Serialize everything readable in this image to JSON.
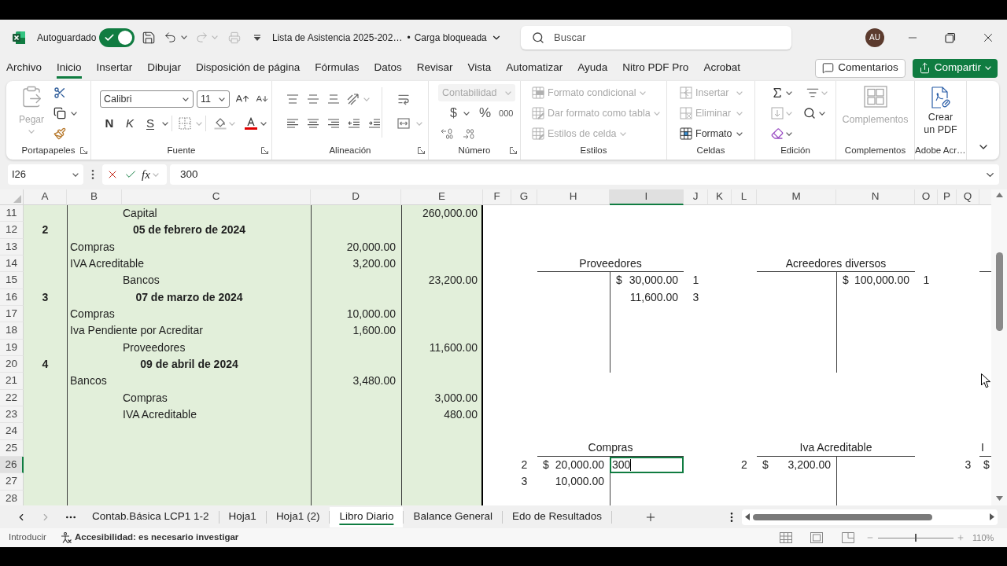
{
  "title_bar": {
    "autosave": {
      "label": "Autoguardado",
      "on": true
    },
    "document_title": "Lista de Asistencia 2025-202…",
    "separator": "•",
    "status": "Carga bloqueada",
    "search": {
      "placeholder": "Buscar"
    },
    "avatar": "AU"
  },
  "menu": {
    "tabs": [
      {
        "label": "Archivo",
        "selected": false
      },
      {
        "label": "Inicio",
        "selected": true
      },
      {
        "label": "Insertar",
        "selected": false
      },
      {
        "label": "Dibujar",
        "selected": false
      },
      {
        "label": "Disposición de página",
        "selected": false
      },
      {
        "label": "Fórmulas",
        "selected": false
      },
      {
        "label": "Datos",
        "selected": false
      },
      {
        "label": "Revisar",
        "selected": false
      },
      {
        "label": "Vista",
        "selected": false
      },
      {
        "label": "Automatizar",
        "selected": false
      },
      {
        "label": "Ayuda",
        "selected": false
      },
      {
        "label": "Nitro PDF Pro",
        "selected": false
      },
      {
        "label": "Acrobat",
        "selected": false
      }
    ],
    "comments": "Comentarios",
    "share": "Compartir"
  },
  "ribbon": {
    "clipboard": {
      "paste": {
        "label": "Pegar",
        "disabled": true
      },
      "label": "Portapapeles"
    },
    "font": {
      "name": "Calibri",
      "size": "11",
      "styles": [
        {
          "kind": "bold",
          "label": "N"
        },
        {
          "kind": "italic",
          "label": "K"
        },
        {
          "kind": "underline",
          "label": "S"
        }
      ],
      "label": "Fuente"
    },
    "alignment": {
      "label": "Alineación"
    },
    "number": {
      "format": {
        "label": "Contabilidad",
        "disabled": true
      },
      "symbols": [
        "$",
        "%",
        "000"
      ],
      "label": "Número"
    },
    "styles": {
      "items": [
        {
          "label": "Formato condicional",
          "disabled": true
        },
        {
          "label": "Dar formato como tabla",
          "disabled": true
        },
        {
          "label": "Estilos de celda",
          "disabled": true
        }
      ],
      "label": "Estilos"
    },
    "cells": {
      "items": [
        {
          "label": "Insertar",
          "disabled": true
        },
        {
          "label": "Eliminar",
          "disabled": true
        },
        {
          "label": "Formato",
          "disabled": false
        }
      ],
      "label": "Celdas"
    },
    "editing": {
      "label": "Edición"
    },
    "addins": {
      "button": {
        "label": "Complementos",
        "disabled": true
      },
      "label": "Complementos"
    },
    "adobe": {
      "button": "Crear un PDF",
      "label": "Adobe Acr…"
    }
  },
  "formula_bar": {
    "name_box": "I26",
    "function": "fx",
    "value": "300"
  },
  "sheet": {
    "columns": [
      {
        "label": "A",
        "selected": false
      },
      {
        "label": "B",
        "selected": false
      },
      {
        "label": "C",
        "selected": false
      },
      {
        "label": "D",
        "selected": false
      },
      {
        "label": "E",
        "selected": false
      },
      {
        "label": "F",
        "selected": false
      },
      {
        "label": "G",
        "selected": false
      },
      {
        "label": "H",
        "selected": false
      },
      {
        "label": "I",
        "selected": true
      },
      {
        "label": "J",
        "selected": false
      },
      {
        "label": "K",
        "selected": false
      },
      {
        "label": "L",
        "selected": false
      },
      {
        "label": "M",
        "selected": false
      },
      {
        "label": "N",
        "selected": false
      },
      {
        "label": "O",
        "selected": false
      },
      {
        "label": "P",
        "selected": false
      },
      {
        "label": "Q",
        "selected": false
      }
    ],
    "rows": [
      {
        "number": "11",
        "selected": false,
        "kind": "credit",
        "account": "Capital",
        "amount": "260,000.00"
      },
      {
        "number": "12",
        "selected": false,
        "kind": "date",
        "entry": "2",
        "date": "05 de febrero de 2024"
      },
      {
        "number": "13",
        "selected": false,
        "kind": "debit",
        "account": "Compras",
        "amount": "20,000.00"
      },
      {
        "number": "14",
        "selected": false,
        "kind": "debit",
        "account": "IVA Acreditable",
        "amount": "3,200.00"
      },
      {
        "number": "15",
        "selected": false,
        "kind": "credit",
        "account": "Bancos",
        "amount": "23,200.00"
      },
      {
        "number": "16",
        "selected": false,
        "kind": "date",
        "entry": "3",
        "date": "07 de marzo de 2024"
      },
      {
        "number": "17",
        "selected": false,
        "kind": "debit",
        "account": "Compras",
        "amount": "10,000.00"
      },
      {
        "number": "18",
        "selected": false,
        "kind": "debit",
        "account": "Iva Pendiente por Acreditar",
        "amount": "1,600.00"
      },
      {
        "number": "19",
        "selected": false,
        "kind": "credit",
        "account": "Proveedores",
        "amount": "11,600.00"
      },
      {
        "number": "20",
        "selected": false,
        "kind": "date",
        "entry": "4",
        "date": "09 de abril de 2024"
      },
      {
        "number": "21",
        "selected": false,
        "kind": "debit",
        "account": "Bancos",
        "amount": "3,480.00"
      },
      {
        "number": "22",
        "selected": false,
        "kind": "credit",
        "account": "Compras",
        "amount": "3,000.00"
      },
      {
        "number": "23",
        "selected": false,
        "kind": "credit",
        "account": "IVA Acreditable",
        "amount": "480.00"
      },
      {
        "number": "24",
        "selected": false
      },
      {
        "number": "25",
        "selected": false
      },
      {
        "number": "26",
        "selected": true
      },
      {
        "number": "27",
        "selected": false
      },
      {
        "number": "28",
        "selected": false
      }
    ],
    "t_accounts": [
      {
        "kind": "t_account",
        "title": "Proveedores",
        "credits": [
          {
            "currency": "$",
            "amount": "30,000.00",
            "ref": "1",
            "selected": false
          },
          {
            "amount": "11,600.00",
            "ref": "3",
            "selected": false
          }
        ]
      },
      {
        "kind": "t_account",
        "title": "Acreedores diversos",
        "credits": [
          {
            "currency": "$",
            "amount": "100,000.00",
            "ref": "1",
            "selected": false
          }
        ]
      },
      {
        "kind": "t_account"
      },
      {
        "kind": "t_account",
        "title": "Compras",
        "debits": [
          {
            "ref": "2",
            "currency": "$",
            "amount": "20,000.00",
            "selected": false
          },
          {
            "ref": "3",
            "amount": "10,000.00",
            "selected": false
          }
        ],
        "credits": [
          {
            "amount": "300",
            "selected": true
          }
        ]
      },
      {
        "kind": "t_account",
        "title": "Iva Acreditable",
        "debits": [
          {
            "ref": "2",
            "currency": "$",
            "amount": "3,200.00",
            "selected": false
          }
        ]
      },
      {
        "kind": "t_account",
        "title": "I",
        "debits": [
          {
            "ref": "3",
            "currency": "$",
            "selected": false
          }
        ]
      }
    ]
  },
  "sheet_tabs": [
    {
      "label": "Contab.Básica LCP1 1-2",
      "selected": false
    },
    {
      "label": "Hoja1",
      "selected": false
    },
    {
      "label": "Hoja1 (2)",
      "selected": false
    },
    {
      "label": "Libro Diario",
      "selected": true
    },
    {
      "label": "Balance General",
      "selected": false
    },
    {
      "label": "Edo de Resultados",
      "selected": false
    }
  ],
  "status_bar": {
    "mode": "Introducir",
    "accessibility": "Accesibilidad: es necesario investigar",
    "zoom": {
      "level": 0.5,
      "reading": "110%"
    }
  }
}
